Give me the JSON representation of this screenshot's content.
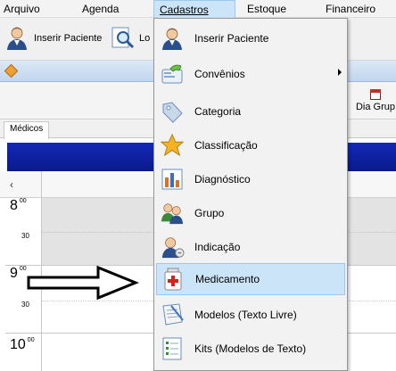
{
  "menubar": {
    "items": [
      {
        "label": "Arquivo"
      },
      {
        "label": "Agenda"
      },
      {
        "label": "Cadastros"
      },
      {
        "label": "Estoque"
      },
      {
        "label": "Financeiro"
      }
    ]
  },
  "toolbar": {
    "inserir_paciente": "Inserir Paciente",
    "partial_button": "Lo"
  },
  "child": {
    "dia_grupo": "Dia Grup",
    "tab_medicos": "Médicos",
    "nav_prev": "‹",
    "hours": [
      {
        "hour": "8",
        "min": "00",
        "half": "30"
      },
      {
        "hour": "9",
        "min": "00",
        "half": "30"
      },
      {
        "hour": "10",
        "min": "00"
      }
    ]
  },
  "dropdown": {
    "items": [
      {
        "label": "Inserir Paciente",
        "icon": "patient-icon"
      },
      {
        "label": "Convênios",
        "icon": "handshake-card-icon",
        "submenu": true
      },
      {
        "label": "Categoria",
        "icon": "tag-icon"
      },
      {
        "label": "Classificação",
        "icon": "star-icon"
      },
      {
        "label": "Diagnóstico",
        "icon": "chart-icon"
      },
      {
        "label": "Grupo",
        "icon": "group-icon"
      },
      {
        "label": "Indicação",
        "icon": "referral-icon"
      },
      {
        "label": "Medicamento",
        "icon": "medicine-icon",
        "highlighted": true
      },
      {
        "label": "Modelos (Texto Livre)",
        "icon": "notebook-icon"
      },
      {
        "label": "Kits (Modelos de Texto)",
        "icon": "kit-list-icon"
      }
    ]
  },
  "colors": {
    "menu_highlight": "#cce4f7",
    "menu_highlight_border": "#99c9ef",
    "blue_band": "#12249f",
    "star": "#f5b323",
    "medicine_cross": "#d42222"
  }
}
